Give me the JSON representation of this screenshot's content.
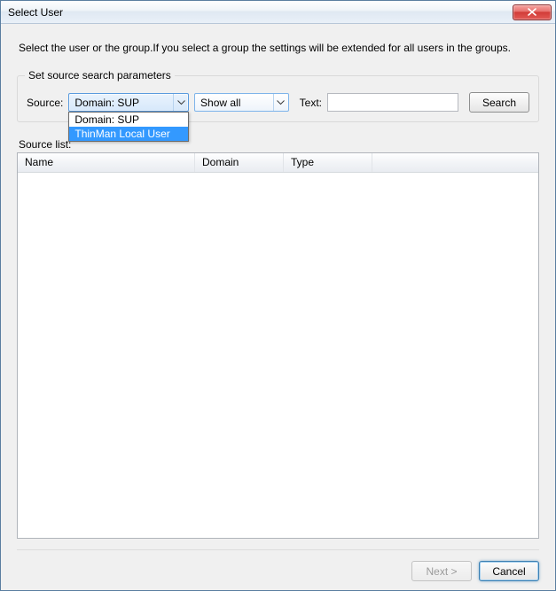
{
  "window": {
    "title": "Select User"
  },
  "instruction": "Select the user or the group.If you select a group the settings will be extended for all users in the groups.",
  "search": {
    "legend": "Set source search parameters",
    "source_label": "Source:",
    "source_value": "Domain: SUP",
    "source_options": [
      "Domain: SUP",
      "ThinMan Local User"
    ],
    "source_highlight_index": 1,
    "filter_value": "Show all",
    "text_label": "Text:",
    "text_value": "",
    "search_button": "Search"
  },
  "list": {
    "label": "Source list:",
    "columns": [
      "Name",
      "Domain",
      "Type"
    ],
    "rows": []
  },
  "footer": {
    "next": "Next >",
    "cancel": "Cancel"
  }
}
